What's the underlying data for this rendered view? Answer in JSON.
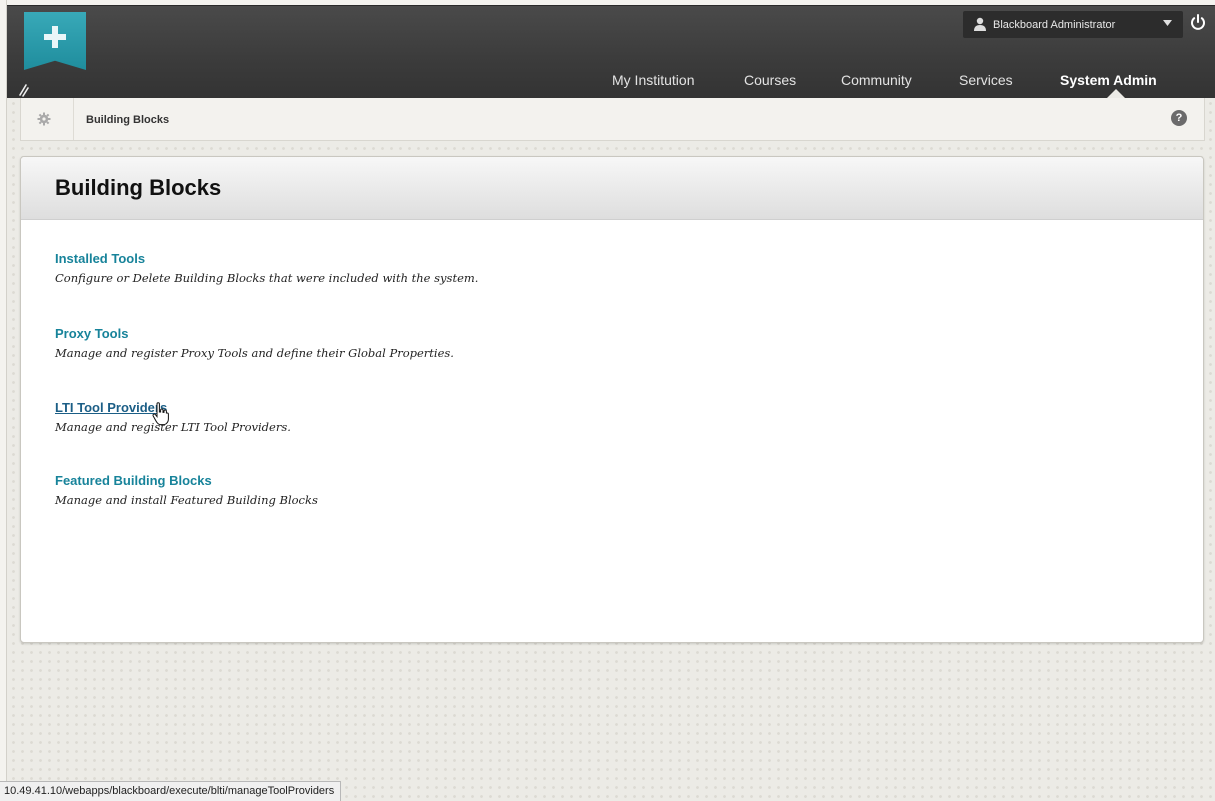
{
  "header": {
    "logo_icon": "plus-icon",
    "edit_icon": "edit-mode-icon",
    "user_name": "Blackboard Administrator",
    "nav": [
      {
        "label": "My Institution"
      },
      {
        "label": "Courses"
      },
      {
        "label": "Community"
      },
      {
        "label": "Services"
      },
      {
        "label": "System Admin",
        "active": true
      }
    ]
  },
  "breadcrumb": {
    "label": "Building Blocks",
    "help": "?"
  },
  "panel": {
    "title": "Building Blocks",
    "tools": [
      {
        "label": "Installed Tools",
        "description": "Configure or Delete Building Blocks that were included with the system."
      },
      {
        "label": "Proxy Tools",
        "description": "Manage and register Proxy Tools and define their Global Properties."
      },
      {
        "label": "LTI Tool Providers",
        "description": "Manage and register LTI Tool Providers."
      },
      {
        "label": "Featured Building Blocks",
        "description": "Manage and install Featured Building Blocks"
      }
    ]
  },
  "status_bar": {
    "url": "10.49.41.10/webapps/blackboard/execute/blti/manageToolProviders"
  },
  "colors": {
    "accent_teal": "#1f8d9d",
    "link": "#17839a",
    "header_bg": "#3b3b3b"
  }
}
